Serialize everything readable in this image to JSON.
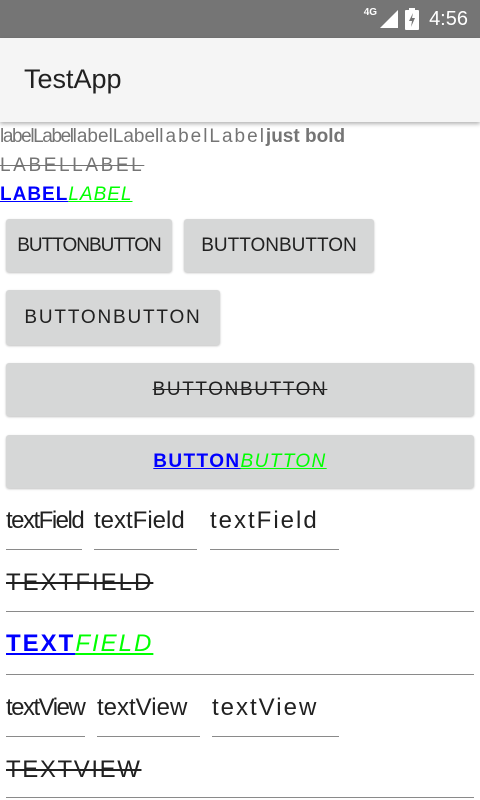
{
  "status_bar": {
    "network": "4G",
    "time": "4:56"
  },
  "app_bar": {
    "title": "TestApp"
  },
  "labels": {
    "row1": {
      "condensed": "labelLabel",
      "normal": "labelLabel",
      "spaced": "labelLabel",
      "bold": "just bold"
    },
    "row2": "LABELLABEL",
    "row3": {
      "part1": "LABEL",
      "part2": "LABEL"
    }
  },
  "buttons": {
    "condensed": "BUTTONBUTTON",
    "normal": "BUTTONBUTTON",
    "spaced": "BUTTONBUTTON",
    "strike": "BUTTONBUTTON",
    "styled": {
      "part1": "BUTTON",
      "part2": "BUTTON"
    }
  },
  "text_fields": {
    "condensed": "textField",
    "normal": "textField",
    "spaced": "textField",
    "strike": "TEXTFIELD",
    "styled": {
      "part1": "TEXT",
      "part2": "FIELD"
    }
  },
  "text_views": {
    "condensed": "textView",
    "normal": "textView",
    "spaced": "textView",
    "strike": "TEXTVIEW"
  },
  "colors": {
    "status_bar": "#757575",
    "app_bar": "#f5f5f5",
    "button": "#d6d7d7",
    "blue": "#0000ff",
    "green": "#00ff00"
  }
}
